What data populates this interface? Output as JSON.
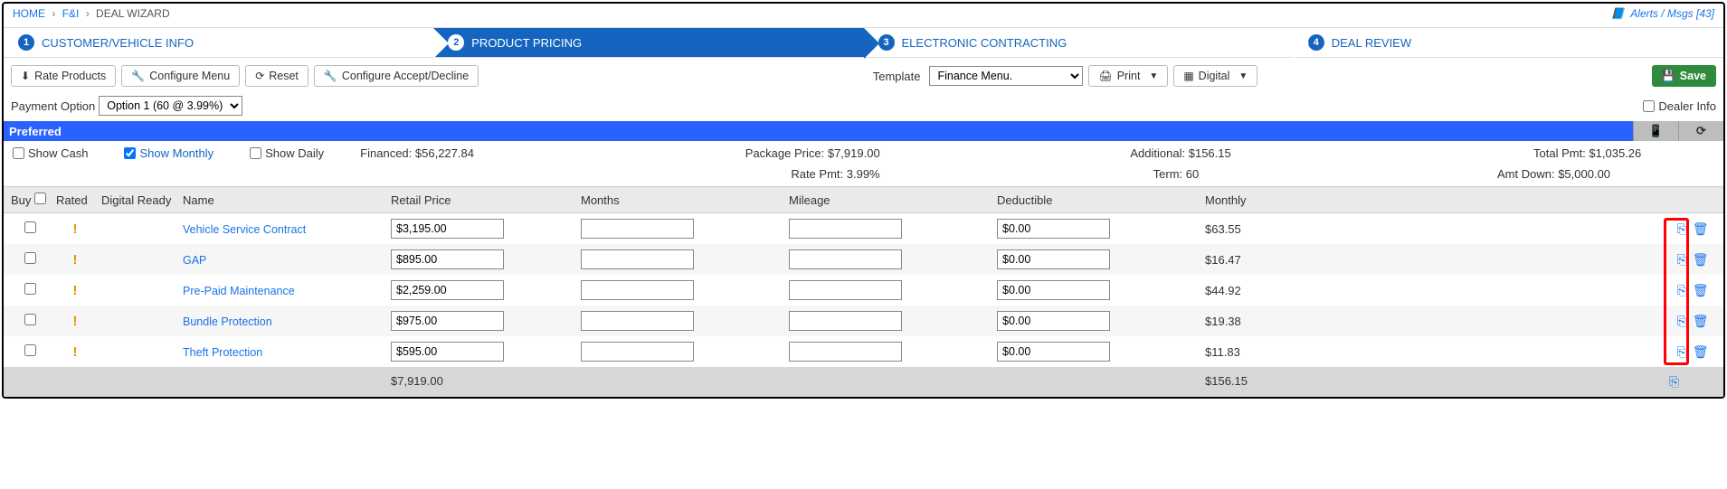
{
  "breadcrumb": {
    "home": "HOME",
    "fi": "F&I",
    "current": "DEAL WIZARD",
    "alerts_label": "Alerts / Msgs",
    "alerts_count": "[43]"
  },
  "steps": [
    {
      "num": "1",
      "label": "CUSTOMER/VEHICLE INFO"
    },
    {
      "num": "2",
      "label": "PRODUCT PRICING"
    },
    {
      "num": "3",
      "label": "ELECTRONIC CONTRACTING"
    },
    {
      "num": "4",
      "label": "DEAL REVIEW"
    }
  ],
  "toolbar": {
    "rate": "Rate Products",
    "config_menu": "Configure Menu",
    "reset": "Reset",
    "config_ad": "Configure Accept/Decline",
    "template_label": "Template",
    "template_value": "Finance Menu.",
    "print": "Print",
    "digital": "Digital",
    "save": "Save"
  },
  "payopt": {
    "label": "Payment Option",
    "value": "Option 1 (60 @ 3.99%)",
    "dealer_info": "Dealer Info"
  },
  "bluebar": {
    "title": "Preferred"
  },
  "show": {
    "cash": "Show Cash",
    "monthly": "Show Monthly",
    "daily": "Show Daily"
  },
  "summary": {
    "financed_label": "Financed:",
    "financed": "$56,227.84",
    "package_label": "Package Price:",
    "package": "$7,919.00",
    "additional_label": "Additional:",
    "additional": "$156.15",
    "total_label": "Total Pmt:",
    "total": "$1,035.26",
    "ratepmt_label": "Rate Pmt:",
    "ratepmt": "3.99%",
    "term_label": "Term:",
    "term": "60",
    "amtdown_label": "Amt Down:",
    "amtdown": "$5,000.00"
  },
  "cols": {
    "buy": "Buy",
    "rated": "Rated",
    "digital_ready": "Digital Ready",
    "name": "Name",
    "retail": "Retail Price",
    "months": "Months",
    "mileage": "Mileage",
    "deductible": "Deductible",
    "monthly": "Monthly"
  },
  "rows": [
    {
      "name": "Vehicle Service Contract",
      "retail": "$3,195.00",
      "months": "",
      "mileage": "",
      "deductible": "$0.00",
      "monthly": "$63.55"
    },
    {
      "name": "GAP",
      "retail": "$895.00",
      "months": "",
      "mileage": "",
      "deductible": "$0.00",
      "monthly": "$16.47"
    },
    {
      "name": "Pre-Paid Maintenance",
      "retail": "$2,259.00",
      "months": "",
      "mileage": "",
      "deductible": "$0.00",
      "monthly": "$44.92"
    },
    {
      "name": "Bundle Protection",
      "retail": "$975.00",
      "months": "",
      "mileage": "",
      "deductible": "$0.00",
      "monthly": "$19.38"
    },
    {
      "name": "Theft Protection",
      "retail": "$595.00",
      "months": "",
      "mileage": "",
      "deductible": "$0.00",
      "monthly": "$11.83"
    }
  ],
  "totals": {
    "retail": "$7,919.00",
    "monthly": "$156.15"
  }
}
